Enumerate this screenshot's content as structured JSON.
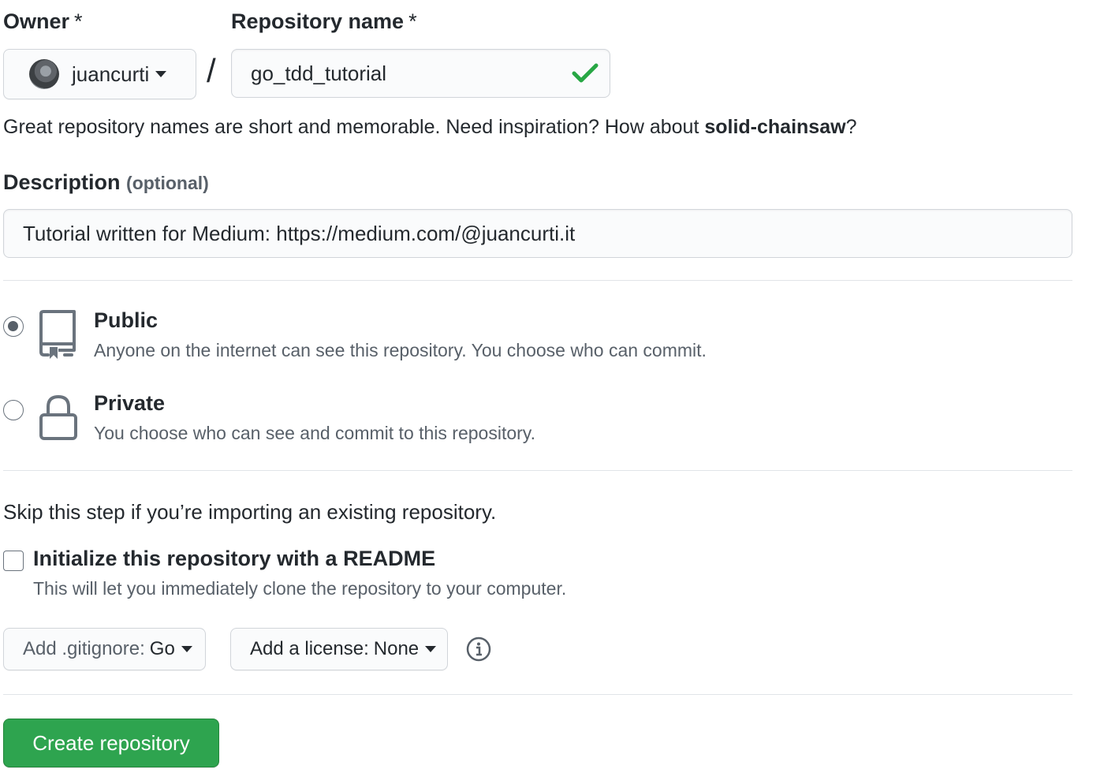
{
  "owner": {
    "label": "Owner",
    "required_mark": "*",
    "value": "juancurti"
  },
  "separator": "/",
  "repo_name": {
    "label": "Repository name",
    "required_mark": "*",
    "value": "go_tdd_tutorial"
  },
  "suggestion": {
    "prefix": "Great repository names are short and memorable. Need inspiration? How about ",
    "name": "solid-chainsaw",
    "suffix": "?"
  },
  "description": {
    "label": "Description",
    "optional": "(optional)",
    "value": "Tutorial written for Medium: https://medium.com/@juancurti.it"
  },
  "visibility": {
    "public": {
      "title": "Public",
      "note": "Anyone on the internet can see this repository. You choose who can commit.",
      "selected": true
    },
    "private": {
      "title": "Private",
      "note": "You choose who can see and commit to this repository.",
      "selected": false
    }
  },
  "init": {
    "skip_note": "Skip this step if you’re importing an existing repository.",
    "readme_label": "Initialize this repository with a README",
    "readme_note": "This will let you immediately clone the repository to your computer.",
    "readme_checked": false
  },
  "gitignore": {
    "prefix": "Add .gitignore:",
    "value": "Go"
  },
  "license": {
    "prefix": "Add a license:",
    "value": "None"
  },
  "submit": {
    "label": "Create repository"
  },
  "colors": {
    "accent_green": "#2ea44f",
    "check_green": "#28a745",
    "border": "#d1d5da",
    "muted_text": "#586069"
  },
  "icons": [
    "chevron-down-icon",
    "check-icon",
    "repo-icon",
    "lock-icon",
    "info-icon",
    "avatar"
  ]
}
